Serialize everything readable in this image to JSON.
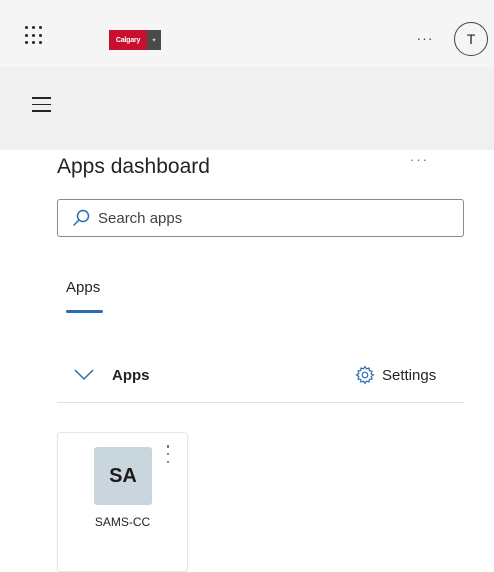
{
  "header": {
    "logo_text": "Calgary",
    "more_label": "···",
    "avatar_initial": "T"
  },
  "page": {
    "title": "Apps dashboard",
    "title_more": "···"
  },
  "search": {
    "placeholder": "Search apps"
  },
  "tabs": [
    {
      "label": "Apps",
      "active": true
    }
  ],
  "section": {
    "label": "Apps",
    "settings_label": "Settings"
  },
  "apps": [
    {
      "initials": "SA",
      "name": "SAMS-CC"
    }
  ],
  "colors": {
    "accent": "#2b6cb0",
    "brand_red": "#c8102e",
    "tile_icon_bg": "#c9d6de"
  },
  "icons": {
    "waffle": "app-launcher-icon",
    "menu": "hamburger-icon",
    "search": "search-icon",
    "chevron": "chevron-down-icon",
    "settings": "gear-icon"
  }
}
